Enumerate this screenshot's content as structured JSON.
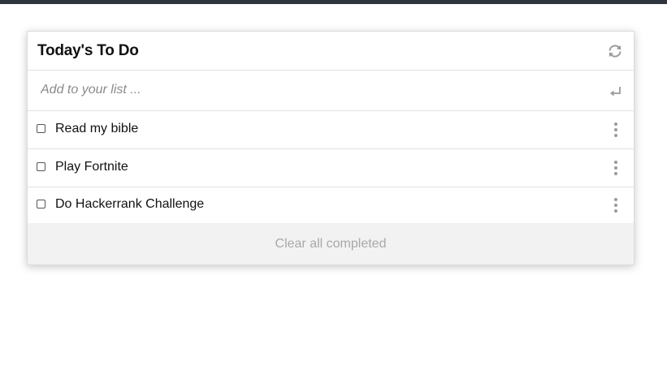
{
  "header": {
    "title": "Today's To Do",
    "refresh_icon": "refresh-icon"
  },
  "add": {
    "placeholder": "Add to your list ...",
    "value": "",
    "submit_icon": "enter-icon"
  },
  "items": [
    {
      "label": "Read my bible",
      "checked": false,
      "menu_icon": "vertical-dots-icon"
    },
    {
      "label": "Play Fortnite",
      "checked": false,
      "menu_icon": "vertical-dots-icon"
    },
    {
      "label": "Do Hackerrank Challenge",
      "checked": false,
      "menu_icon": "vertical-dots-icon"
    }
  ],
  "footer": {
    "clear_label": "Clear all completed"
  },
  "colors": {
    "topbar": "#2f353d",
    "footer_bg": "#f2f2f2",
    "muted_text": "#a8a8a8",
    "icon_gray": "#9a9a9a"
  }
}
